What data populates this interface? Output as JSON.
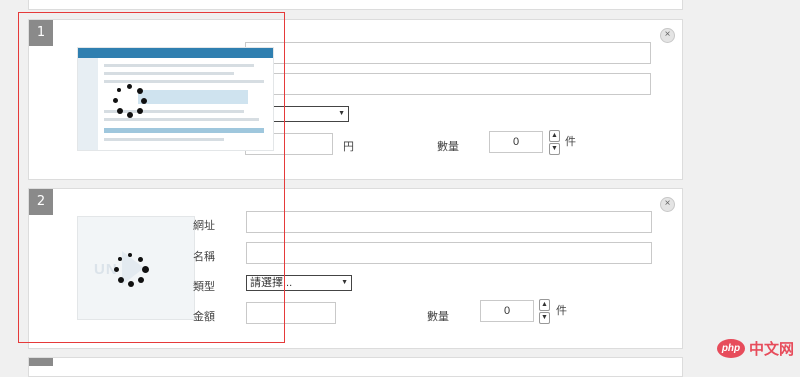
{
  "items": [
    {
      "number": "1",
      "close_icon": "×",
      "select_value": "...",
      "currency_unit": "円",
      "quantity_label": "數量",
      "quantity_value": "0",
      "quantity_unit": "件"
    },
    {
      "number": "2",
      "placeholder_text": "UN",
      "close_icon": "×",
      "url_label": "網址",
      "name_label": "名稱",
      "type_label": "類型",
      "select_value": "請選擇...",
      "amount_label": "金額",
      "quantity_label": "數量",
      "quantity_value": "0",
      "quantity_unit": "件"
    }
  ],
  "watermark": {
    "logo": "php",
    "text": "中文网"
  },
  "highlight_color": "#e53a3a",
  "icons": [
    "close-icon",
    "loading-spinner-icon",
    "chevron-up-icon",
    "chevron-down-icon",
    "dropdown-arrow-icon"
  ]
}
